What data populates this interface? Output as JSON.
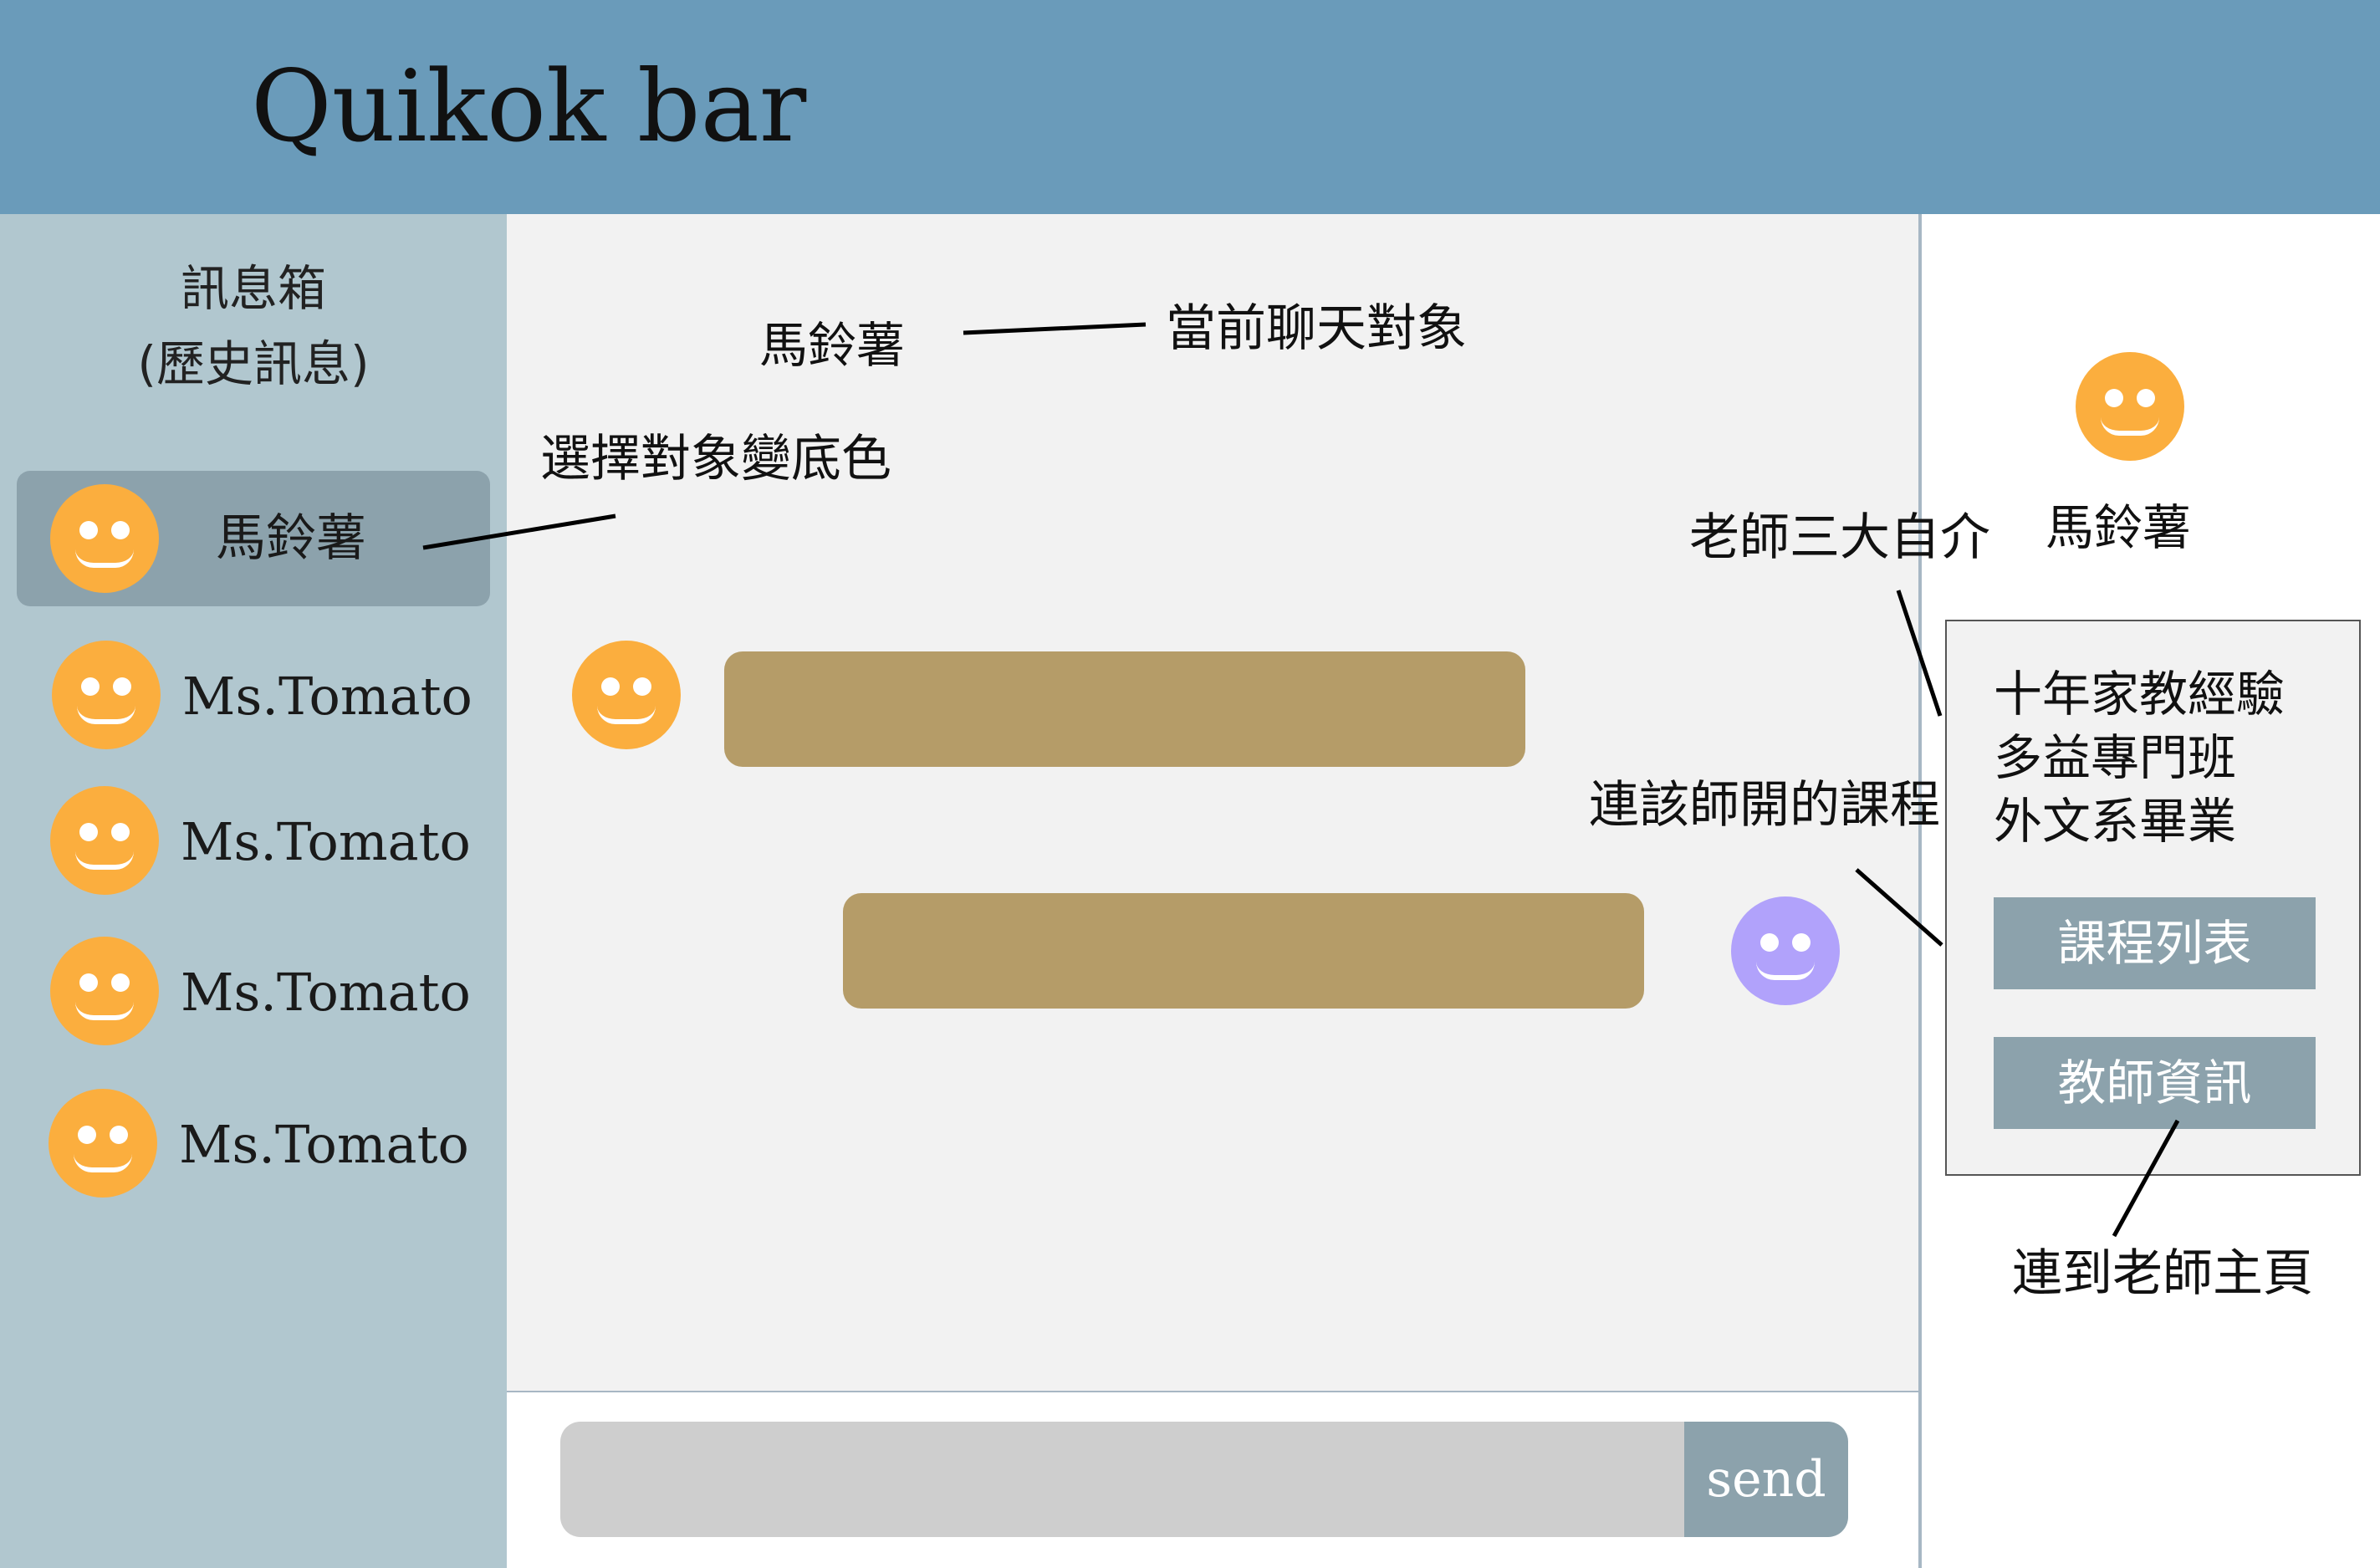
{
  "header": {
    "title": "Quikok bar"
  },
  "sidebar": {
    "heading": "訊息箱",
    "subheading": "(歷史訊息)",
    "contacts": [
      {
        "name": "馬鈴薯",
        "selected": true,
        "avatar": "smiley-icon"
      },
      {
        "name": "Ms.Tomato",
        "selected": false,
        "avatar": "smiley-icon"
      },
      {
        "name": "Ms.Tomato",
        "selected": false,
        "avatar": "smiley-icon"
      },
      {
        "name": "Ms.Tomato",
        "selected": false,
        "avatar": "smiley-icon"
      },
      {
        "name": "Ms.Tomato",
        "selected": false,
        "avatar": "smiley-icon"
      }
    ]
  },
  "chat": {
    "partner_name": "馬鈴薯",
    "send_label": "send"
  },
  "profile": {
    "name": "馬鈴薯",
    "intro": [
      "十年家教經驗",
      "多益專門班",
      "外文系畢業"
    ],
    "courses_button": "課程列表",
    "teacher_info_button": "教師資訊"
  },
  "annotations": {
    "current_partner": "當前聊天對象",
    "selected_bg": "選擇對象變底色",
    "teacher_intro": "老師三大自介",
    "teacher_courses": "連該師開的課程",
    "teacher_home": "連到老師主頁"
  },
  "colors": {
    "header": "#6a9bba",
    "sidebar": "#b1c7cf",
    "selected": "#8ca2ac",
    "bubble": "#b59c68",
    "avatar_orange": "#fbae3e",
    "avatar_purple": "#b1a2fb"
  }
}
